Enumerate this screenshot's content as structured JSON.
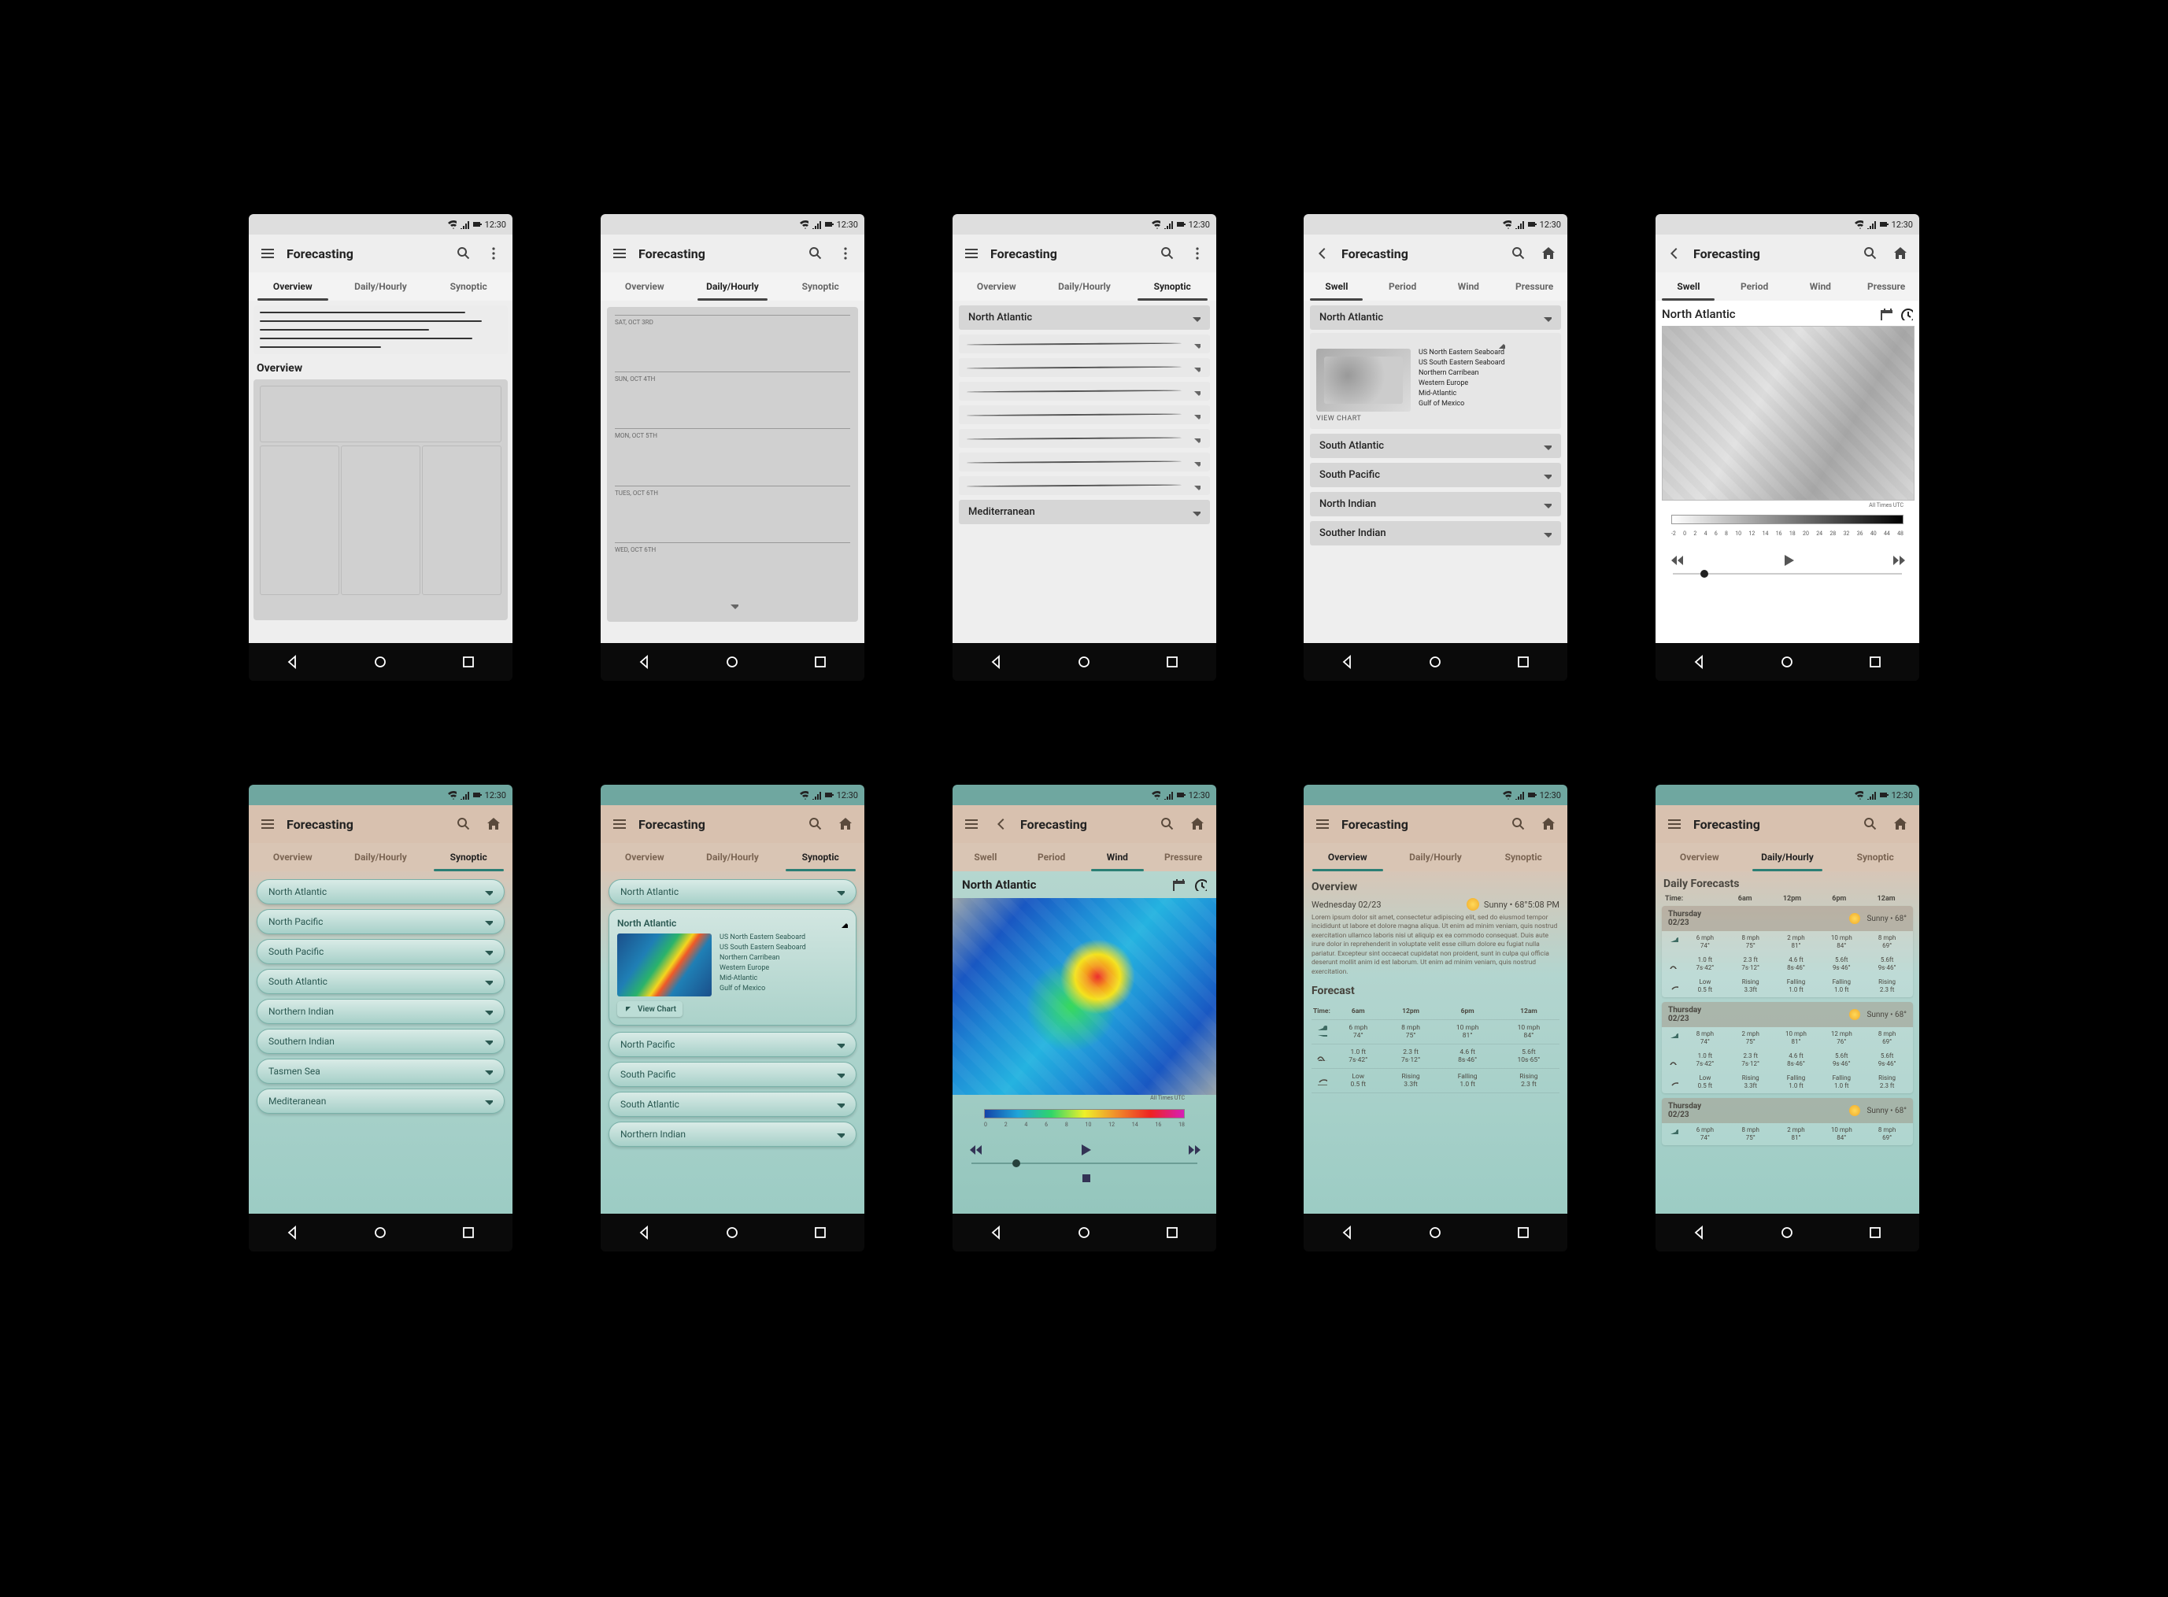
{
  "status_time": "12:30",
  "app_title": "Forecasting",
  "tabs_main": [
    "Overview",
    "Daily/Hourly",
    "Synoptic"
  ],
  "tabs_chart": [
    "Swell",
    "Period",
    "Wind",
    "Pressure"
  ],
  "r1s1": {
    "overview_label": "Overview"
  },
  "r1s2": {
    "days": [
      "SAT, OCT 3RD",
      "SUN, OCT 4TH",
      "MON, OCT 5TH",
      "TUES, OCT 6TH",
      "WED, OCT 6TH"
    ]
  },
  "r1s3": {
    "top": "North Atlantic",
    "bottom": "Mediterranean"
  },
  "r1s4": {
    "expanded_region": "North Atlantic",
    "sub_regions": [
      "US North Eastern Seaboard",
      "US South Eastern Seaboard",
      "Northern Carribean",
      "Western Europe",
      "Mid-Atlantic",
      "Gulf of Mexico"
    ],
    "view_chart": "VIEW CHART",
    "others": [
      "South Atlantic",
      "South Pacific",
      "North Indian",
      "Souther Indian"
    ]
  },
  "r1s5": {
    "map_title": "North Atlantic",
    "utc_label": "All Times UTC",
    "scale_ticks": [
      "-2",
      "0",
      "2",
      "4",
      "6",
      "8",
      "10",
      "12",
      "14",
      "16",
      "18",
      "20",
      "24",
      "28",
      "32",
      "36",
      "40",
      "44",
      "48"
    ]
  },
  "r2s1": {
    "regions": [
      "North Atlantic",
      "North Pacific",
      "South Pacific",
      "South Atlantic",
      "Northern Indian",
      "Southern Indian",
      "Tasmen Sea",
      "Mediteranean"
    ]
  },
  "r2s2": {
    "region": "North Atlantic",
    "subs": [
      "US North Eastern Seaboard",
      "US South Eastern Seaboard",
      "Northern Carribean",
      "Western Europe",
      "Mid-Atlantic",
      "Gulf of Mexico"
    ],
    "view_chart": "View Chart",
    "others": [
      "North Pacific",
      "South Pacific",
      "South Atlantic",
      "Northern Indian"
    ]
  },
  "r2s3": {
    "map_title": "North Atlantic",
    "utc_label": "All Times UTC",
    "scale_ticks": [
      "0",
      "2",
      "4",
      "6",
      "8",
      "10",
      "12",
      "14",
      "16",
      "18"
    ]
  },
  "r2s4": {
    "overview_h": "Overview",
    "date": "Wednesday 02/23",
    "weather": "Sunny • 68°5:08 PM",
    "lorem": "Lorem ipsum dolor sit amet, consectetur adipiscing elit, sed do eiusmod tempor incididunt ut labore et dolore magna aliqua. Ut enim ad minim veniam, quis nostrud exercitation ullamco laboris nisi ut aliquip ex ea commodo consequat. Duis aute irure dolor in reprehenderit in voluptate velit esse cillum dolore eu fugiat nulla pariatur. Excepteur sint occaecat cupidatat non proident, sunt in culpa qui officia deserunt mollit anim id est laborum. Ut enim ad minim veniam, quis nostrud exercitation.",
    "forecast_h": "Forecast",
    "cols": [
      "Time:",
      "6am",
      "12pm",
      "6pm",
      "12am"
    ],
    "rows": [
      {
        "icon": "wind",
        "c": [
          [
            "6 mph",
            "74°"
          ],
          [
            "8 mph",
            "75°"
          ],
          [
            "10 mph",
            "81°"
          ],
          [
            "10 mph",
            "84°"
          ]
        ]
      },
      {
        "icon": "wave",
        "c": [
          [
            "1.0 ft",
            "7s·42°"
          ],
          [
            "2.3 ft",
            "7s·12°"
          ],
          [
            "4.6 ft",
            "8s·46°"
          ],
          [
            "5.6ft",
            "10s·65°"
          ]
        ]
      },
      {
        "icon": "tide",
        "c": [
          [
            "Low",
            "0.5 ft"
          ],
          [
            "Rising",
            "3.3ft"
          ],
          [
            "Falling",
            "1.0 ft"
          ],
          [
            "Rising",
            "2.3 ft"
          ]
        ]
      }
    ]
  },
  "r2s5": {
    "h": "Daily Forecasts",
    "cols": [
      "Time:",
      "6am",
      "12pm",
      "6pm",
      "12am"
    ],
    "days": [
      {
        "name": "Thursday",
        "date": "02/23",
        "wx": "Sunny • 68°",
        "rows": [
          {
            "icon": "wind",
            "c": [
              [
                "6 mph",
                "74°"
              ],
              [
                "8 mph",
                "75°"
              ],
              [
                "2 mph",
                "81°"
              ],
              [
                "10 mph",
                "84°"
              ],
              [
                "8 mph",
                "69°"
              ]
            ]
          },
          {
            "icon": "wave",
            "c": [
              [
                "1.0 ft",
                "7s·42°"
              ],
              [
                "2.3 ft",
                "7s·12°"
              ],
              [
                "4.6 ft",
                "8s·46°"
              ],
              [
                "5.6ft",
                "9s·46°"
              ],
              [
                "5.6ft",
                "9s·46°"
              ]
            ]
          },
          {
            "icon": "tide",
            "c": [
              [
                "Low",
                "0.5 ft"
              ],
              [
                "Rising",
                "3.3ft"
              ],
              [
                "Falling",
                "1.0 ft"
              ],
              [
                "Falling",
                "1.0 ft"
              ],
              [
                "Rising",
                "2.3 ft"
              ]
            ]
          }
        ]
      },
      {
        "name": "Thursday",
        "date": "02/23",
        "wx": "Sunny • 68°",
        "rows": [
          {
            "icon": "wind",
            "c": [
              [
                "8 mph",
                "74°"
              ],
              [
                "2 mph",
                "75°"
              ],
              [
                "10 mph",
                "81°"
              ],
              [
                "12 mph",
                "76°"
              ],
              [
                "8 mph",
                "69°"
              ]
            ]
          },
          {
            "icon": "wave",
            "c": [
              [
                "1.0 ft",
                "7s·42°"
              ],
              [
                "2.3 ft",
                "7s·12°"
              ],
              [
                "4.6 ft",
                "8s·46°"
              ],
              [
                "5.6ft",
                "9s·46°"
              ],
              [
                "5.6ft",
                "9s·46°"
              ]
            ]
          },
          {
            "icon": "tide",
            "c": [
              [
                "Low",
                "0.5 ft"
              ],
              [
                "Rising",
                "3.3ft"
              ],
              [
                "Falling",
                "1.0 ft"
              ],
              [
                "Falling",
                "1.0 ft"
              ],
              [
                "Rising",
                "2.3 ft"
              ]
            ]
          }
        ]
      },
      {
        "name": "Thursday",
        "date": "02/23",
        "wx": "Sunny • 68°",
        "rows": [
          {
            "icon": "wind",
            "c": [
              [
                "6 mph",
                "74°"
              ],
              [
                "8 mph",
                "75°"
              ],
              [
                "2 mph",
                "81°"
              ],
              [
                "10 mph",
                "84°"
              ],
              [
                "8 mph",
                "69°"
              ]
            ]
          }
        ]
      }
    ]
  },
  "chart_data": {
    "type": "table",
    "title": "Forecast table (row2 screen4)",
    "categories": [
      "6am",
      "12pm",
      "6pm",
      "12am"
    ],
    "series": [
      {
        "name": "wind_mph",
        "values": [
          6,
          8,
          10,
          10
        ]
      },
      {
        "name": "temp_f",
        "values": [
          74,
          75,
          81,
          84
        ]
      },
      {
        "name": "wave_ft",
        "values": [
          1.0,
          2.3,
          4.6,
          5.6
        ]
      },
      {
        "name": "swell_period_s",
        "values": [
          7,
          7,
          8,
          10
        ]
      },
      {
        "name": "swell_dir_deg",
        "values": [
          42,
          12,
          46,
          65
        ]
      },
      {
        "name": "tide_ft",
        "values": [
          0.5,
          3.3,
          1.0,
          2.3
        ]
      }
    ]
  }
}
